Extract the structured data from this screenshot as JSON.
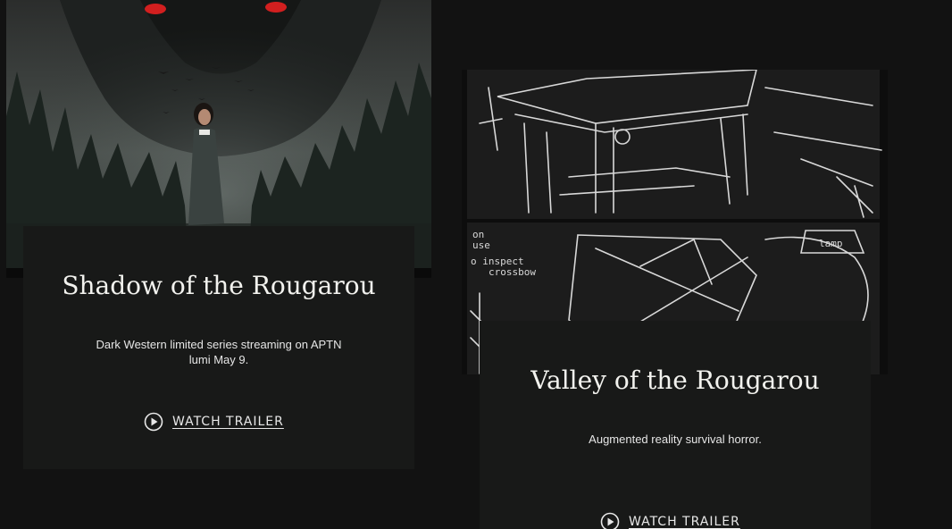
{
  "projects": [
    {
      "title": "Shadow of the Rougarou",
      "description": "Dark Western limited series streaming on APTN lumi May 9.",
      "cta_label": "WATCH TRAILER",
      "cta_icon": "play-circle-icon"
    },
    {
      "title": "Valley of the Rougarou",
      "description": "Augmented reality survival horror.",
      "cta_label": "WATCH TRAILER",
      "cta_icon": "play-circle-icon"
    }
  ],
  "sketch_notes": [
    "on",
    "use",
    "o inspect",
    "crossbow",
    "lamp"
  ],
  "colors": {
    "page_bg": "#121212",
    "card_bg": "#181918",
    "eye_red": "#d21f1f",
    "text": "#f2f2ee"
  }
}
